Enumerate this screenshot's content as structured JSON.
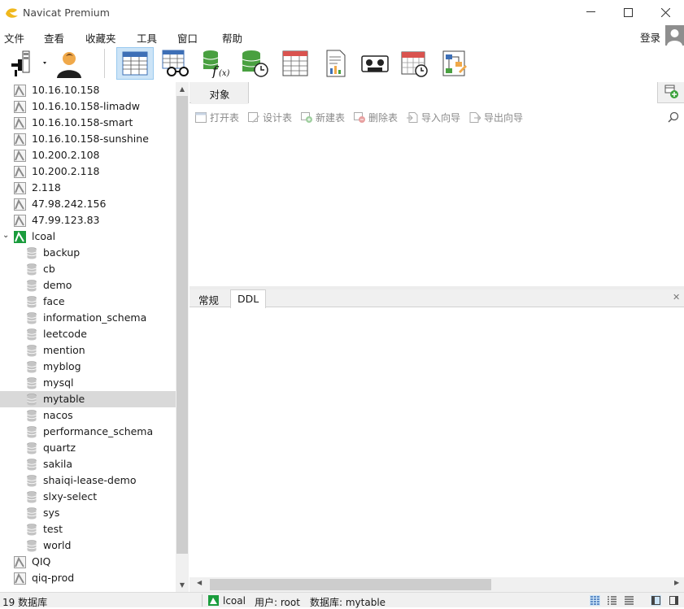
{
  "window": {
    "title": "Navicat Premium"
  },
  "menu": {
    "items": [
      "文件",
      "查看",
      "收藏夹",
      "工具",
      "窗口",
      "帮助"
    ],
    "login": "登录"
  },
  "toolbar": {
    "buttons": [
      "connection",
      "user",
      "table",
      "view",
      "function",
      "event",
      "query",
      "report",
      "backup",
      "schedule",
      "model"
    ]
  },
  "sidebar": {
    "connections_top": [
      "10.16.10.158",
      "10.16.10.158-limadw",
      "10.16.10.158-smart",
      "10.16.10.158-sunshine",
      "10.200.2.108",
      "10.200.2.118",
      "2.118",
      "47.98.242.156",
      "47.99.123.83"
    ],
    "open_connection": "lcoal",
    "databases": [
      "backup",
      "cb",
      "demo",
      "face",
      "information_schema",
      "leetcode",
      "mention",
      "myblog",
      "mysql",
      "mytable",
      "nacos",
      "performance_schema",
      "quartz",
      "sakila",
      "shaiqi-lease-demo",
      "slxy-select",
      "sys",
      "test",
      "world"
    ],
    "selected_database": "mytable",
    "connections_bottom": [
      "QIQ",
      "qiq-prod"
    ]
  },
  "tabs": {
    "objects": "对象"
  },
  "object_toolbar": {
    "open": "打开表",
    "design": "设计表",
    "new": "新建表",
    "delete": "删除表",
    "import": "导入向导",
    "export": "导出向导"
  },
  "info_tabs": {
    "general": "常规",
    "ddl": "DDL"
  },
  "status": {
    "count": "19 数据库",
    "connection": "lcoal",
    "user": "用户: root",
    "database": "数据库: mytable"
  },
  "colors": {
    "accent": "#cce4f7",
    "selected_row": "#d9d9d9",
    "mysql_green": "#1a9c3c"
  }
}
